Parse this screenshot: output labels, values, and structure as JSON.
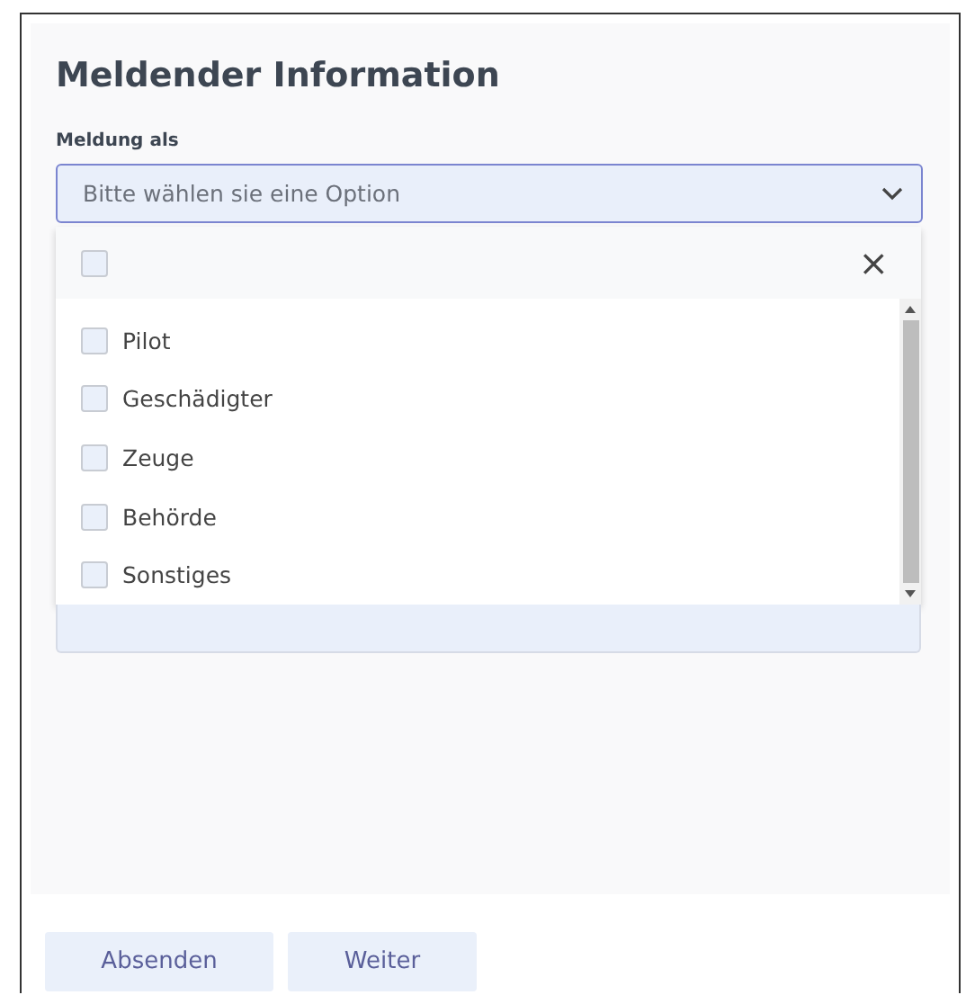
{
  "title": "Meldender Information",
  "field": {
    "label": "Meldung als",
    "placeholder": "Bitte wählen sie eine Option",
    "expanded": true
  },
  "dropdown": {
    "select_all": {
      "checked": false
    },
    "close": "×",
    "options": [
      {
        "label": "Pilot",
        "checked": false
      },
      {
        "label": "Geschädigter",
        "checked": false
      },
      {
        "label": "Zeuge",
        "checked": false
      },
      {
        "label": "Behörde",
        "checked": false
      },
      {
        "label": "Sonstiges",
        "checked": false
      }
    ]
  },
  "buttons": [
    "Absenden",
    "Weiter"
  ]
}
